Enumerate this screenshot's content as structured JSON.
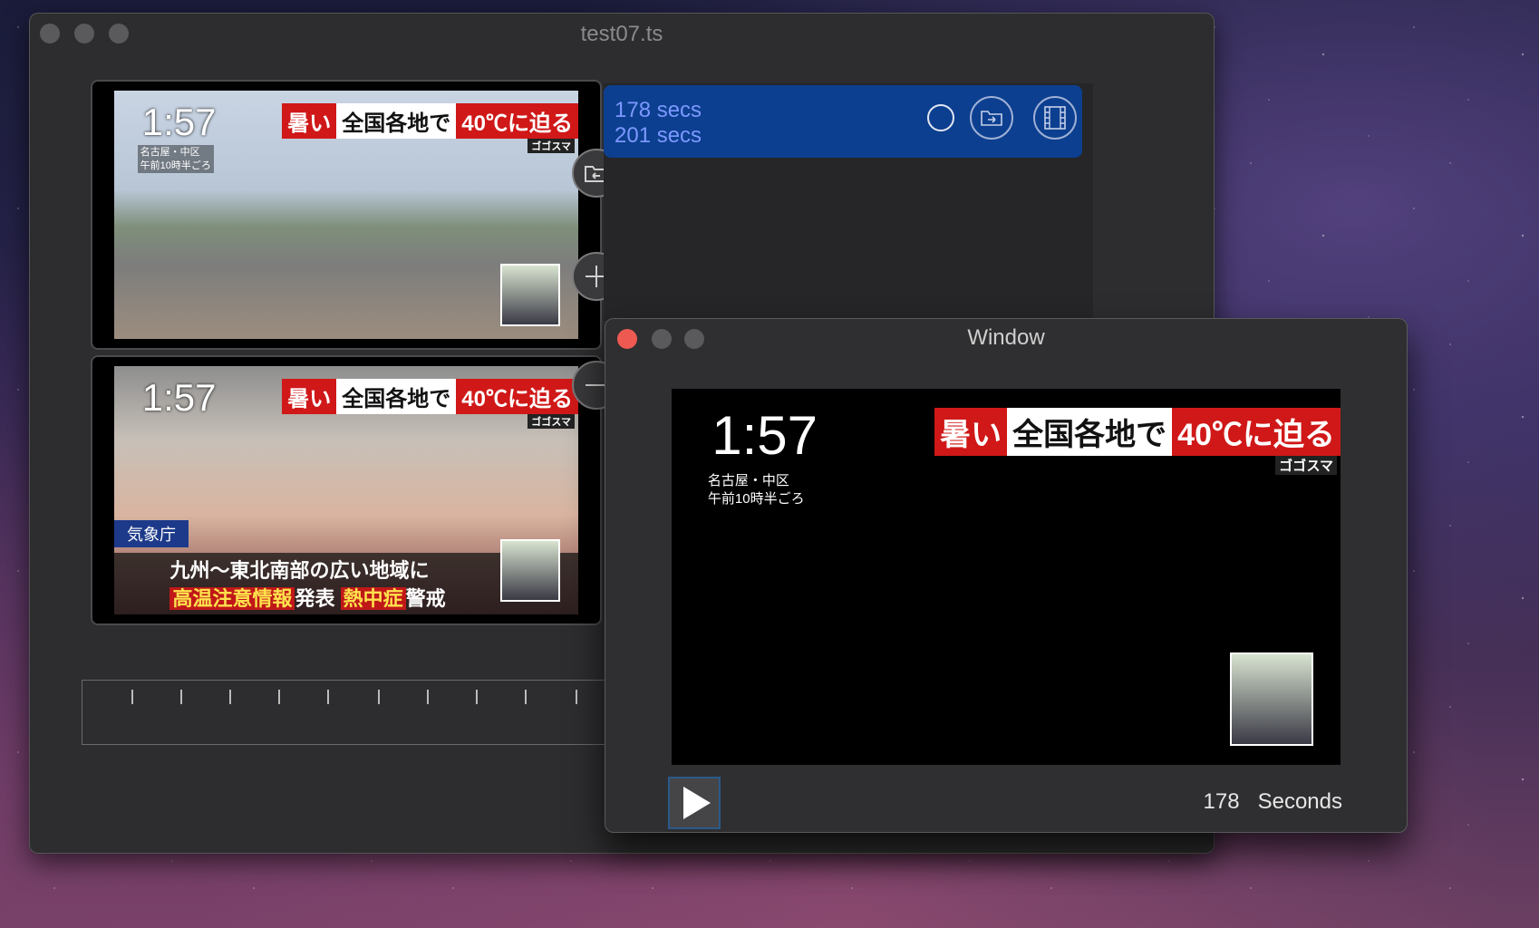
{
  "main_window": {
    "title": "test07.ts",
    "thumbnails": [
      {
        "clock": "1:57",
        "ticker_red": "暑い",
        "ticker_white": "全国各地で",
        "ticker_red2": "40℃に迫る",
        "ticker_source": "ゴゴスマ",
        "location_line1": "名古屋・中区",
        "location_line2": "午前10時半ごろ"
      },
      {
        "clock": "1:57",
        "ticker_red": "暑い",
        "ticker_white": "全国各地で",
        "ticker_red2": "40℃に迫る",
        "ticker_source": "ゴゴスマ",
        "agency": "気象庁",
        "caption_line1": "九州～東北南部の広い地域に",
        "caption_hl1": "高温注意情報",
        "caption_mid": "発表",
        "caption_hl2": "熱中症",
        "caption_end": "警戒"
      }
    ],
    "side_buttons": [
      "back-folder-icon",
      "plus-icon",
      "minus-icon"
    ],
    "list_item": {
      "line1": "178 secs",
      "line2": "201 secs",
      "icons": [
        "circle-icon",
        "export-folder-icon",
        "film-icon"
      ]
    }
  },
  "float_window": {
    "title": "Window",
    "video": {
      "clock": "1:57",
      "ticker_red": "暑い",
      "ticker_white": "全国各地で",
      "ticker_red2": "40℃に迫る",
      "ticker_source": "ゴゴスマ",
      "location_line1": "名古屋・中区",
      "location_line2": "午前10時半ごろ"
    },
    "seconds_value": "178",
    "seconds_label": "Seconds"
  }
}
